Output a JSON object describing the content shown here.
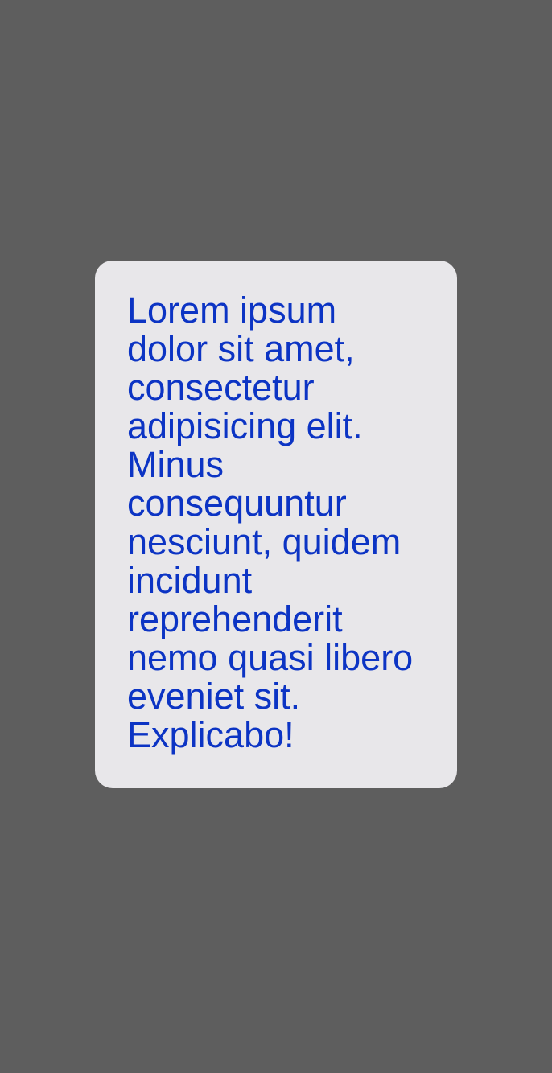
{
  "card": {
    "text": "Lorem ipsum dolor sit amet, consectetur adipisicing elit. Minus consequuntur nesciunt, quidem incidunt reprehenderit nemo quasi libero eveniet sit. Explicabo!"
  },
  "colors": {
    "backdrop": "#5e5e5e",
    "card_background": "#e8e7ea",
    "text": "#0c34c4"
  }
}
